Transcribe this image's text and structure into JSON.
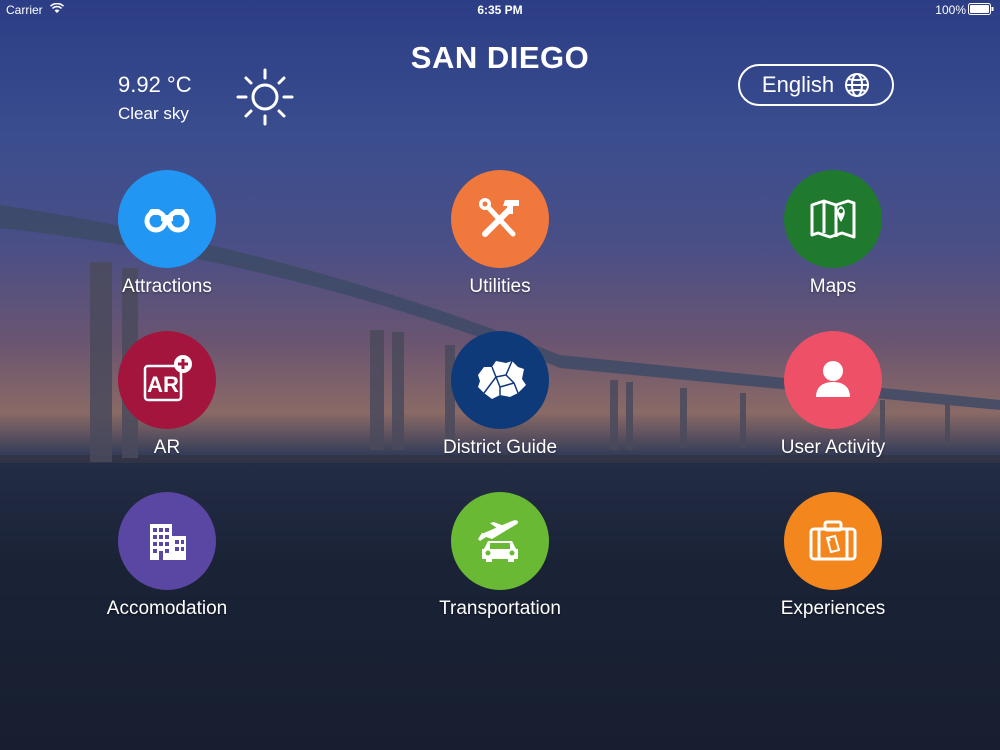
{
  "status_bar": {
    "carrier": "Carrier",
    "time": "6:35 PM",
    "battery": "100%"
  },
  "header": {
    "title": "SAN DIEGO"
  },
  "weather": {
    "temperature": "9.92 °C",
    "condition": "Clear sky",
    "icon": "sun-icon"
  },
  "language": {
    "label": "English",
    "icon": "globe-icon"
  },
  "tiles": [
    {
      "label": "Attractions",
      "icon": "binoculars-icon",
      "color": "#2196f3"
    },
    {
      "label": "Utilities",
      "icon": "tools-icon",
      "color": "#f0783c"
    },
    {
      "label": "Maps",
      "icon": "map-icon",
      "color": "#1f7a2e"
    },
    {
      "label": "AR",
      "icon": "ar-plus-icon",
      "color": "#a3153c"
    },
    {
      "label": "District Guide",
      "icon": "district-map-icon",
      "color": "#0e3a7a"
    },
    {
      "label": "User Activity",
      "icon": "user-icon",
      "color": "#ee5068"
    },
    {
      "label": "Accomodation",
      "icon": "building-icon",
      "color": "#5a46a3"
    },
    {
      "label": "Transportation",
      "icon": "plane-car-icon",
      "color": "#69b935"
    },
    {
      "label": "Experiences",
      "icon": "suitcase-icon",
      "color": "#f3871d"
    }
  ]
}
